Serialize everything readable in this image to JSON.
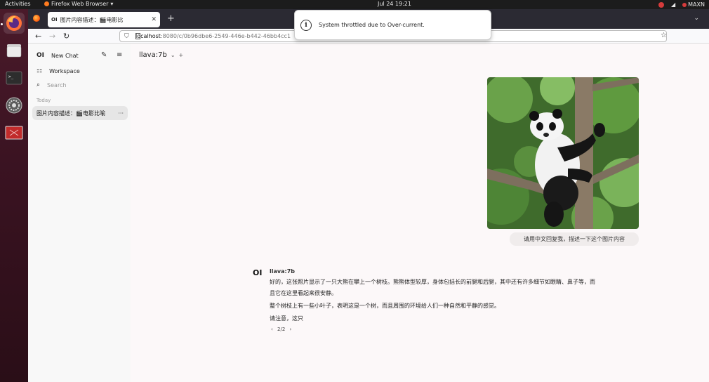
{
  "topbar": {
    "activities": "Activities",
    "app_name": "Firefox Web Browser",
    "clock": "Jul 24  19:21",
    "tray_label": "MAXN"
  },
  "browser": {
    "tab_icon_text": "OI",
    "tab_title": "图片内容描述：🎬电影比",
    "url_host": "localhost",
    "url_rest": ":8080/c/0b96dbe6-2549-446e-b442-46bb4cc1"
  },
  "notification": {
    "message": "System throttled due to Over-current."
  },
  "sidebar": {
    "logo": "OI",
    "new_chat": "New Chat",
    "workspace": "Workspace",
    "search_placeholder": "Search",
    "section_today": "Today",
    "chat_title": "图片内容描述：🎬电影比喻",
    "chat_more": "···"
  },
  "main": {
    "model_name": "llava:7b",
    "add_symbol": "+",
    "user_message": "请用中文回复我，描述一下这个图片内容",
    "ai_logo": "OI",
    "ai_name": "llava:7b",
    "ai_lines": [
      "好的，这张照片显示了一只大熊在攀上一个树枝。熊熊体型较厚，身体包括长的前腿和后腿，其中还有许多细节如眼睛、鼻子等，而",
      "且它在这里看起来很安静。",
      "整个树枝上有一些小叶子，表明这是一个树，而且周围的环境给人们一种自然和平静的感觉。",
      "请注意，这只"
    ],
    "pager": "2/2"
  },
  "colors": {
    "accent_red": "#d53b3b",
    "dock_bg": "#3b1322",
    "tabbar_bg": "#2b2a33"
  }
}
